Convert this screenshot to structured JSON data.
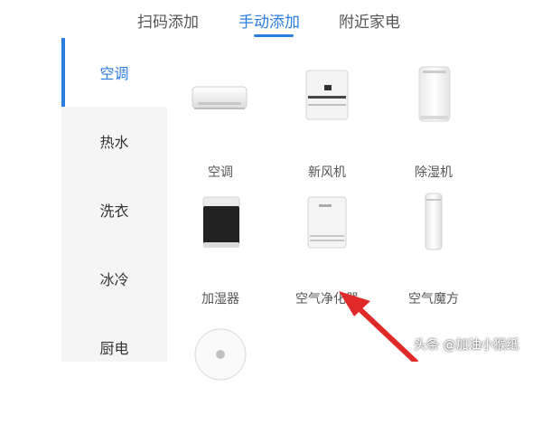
{
  "tabs": [
    {
      "label": "扫码添加"
    },
    {
      "label": "手动添加"
    },
    {
      "label": "附近家电"
    }
  ],
  "sidebar": {
    "items": [
      {
        "label": "空调"
      },
      {
        "label": "热水"
      },
      {
        "label": "洗衣"
      },
      {
        "label": "冰冷"
      },
      {
        "label": "厨电"
      }
    ]
  },
  "devices": [
    {
      "label": "空调",
      "icon": "air-conditioner-icon"
    },
    {
      "label": "新风机",
      "icon": "fresh-air-unit-icon"
    },
    {
      "label": "除湿机",
      "icon": "dehumidifier-icon"
    },
    {
      "label": "加湿器",
      "icon": "humidifier-icon"
    },
    {
      "label": "空气净化器",
      "icon": "air-purifier-icon"
    },
    {
      "label": "空气魔方",
      "icon": "air-cube-icon"
    },
    {
      "label": "",
      "icon": "robot-device-icon"
    }
  ],
  "watermark": "头条 @加油小猴纸",
  "colors": {
    "accent": "#2a7de1",
    "annotation_arrow": "#e02a2a",
    "sidebar_bg": "#f5f5f5"
  }
}
